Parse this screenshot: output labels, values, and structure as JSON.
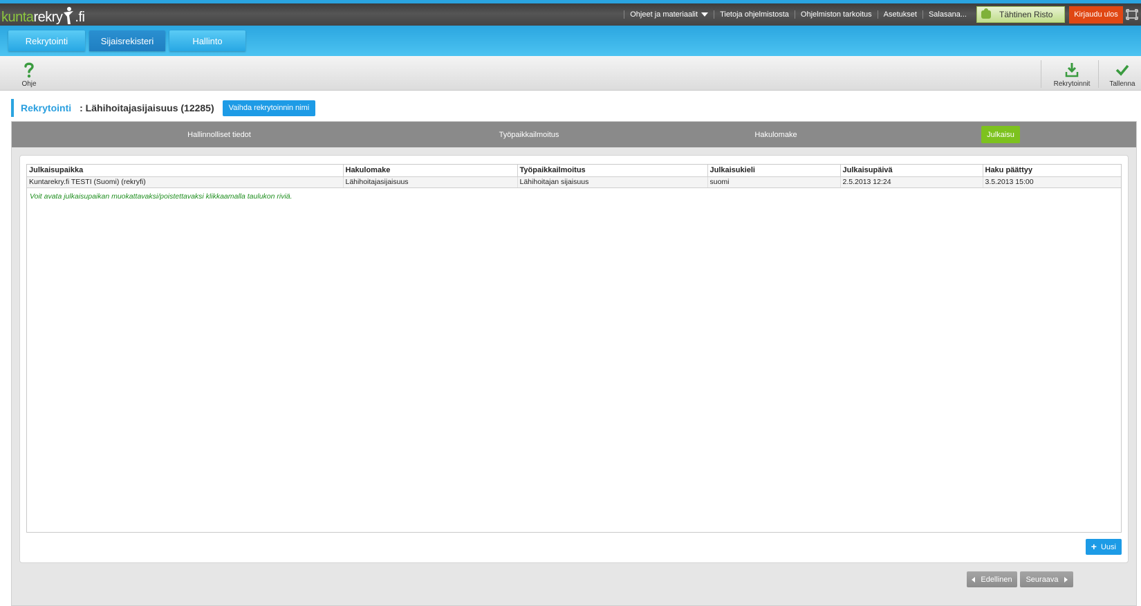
{
  "header": {
    "logo_part1": "kunta",
    "logo_part2": "rekry",
    "logo_part3": ".fi",
    "links": [
      "Ohjeet ja materiaalit",
      "Tietoja ohjelmistosta",
      "Ohjelmiston tarkoitus",
      "Asetukset",
      "Salasana..."
    ],
    "user_name": "Tähtinen Risto",
    "logout_label": "Kirjaudu ulos",
    "user_bg": "#c8e29a",
    "logout_bg": "#e04713"
  },
  "nav": {
    "tabs": [
      "Rekrytointi",
      "Sijaisrekisteri",
      "Hallinto"
    ]
  },
  "toolbar": {
    "help_label": "Ohje",
    "recruitments_label": "Rekrytoinnit",
    "save_label": "Tallenna"
  },
  "page": {
    "section_label": "Rekrytointi",
    "recruitment_title": ": Lähihoitajasijaisuus (12285)",
    "rename_button": "Vaihda rekrytoinnin nimi"
  },
  "steps": [
    "Hallinnolliset tiedot",
    "Työpaikkailmoitus",
    "Hakulomake",
    "Julkaisu"
  ],
  "table": {
    "columns": [
      "Julkaisupaikka",
      "Hakulomake",
      "Työpaikkailmoitus",
      "Julkaisukieli",
      "Julkaisupäivä",
      "Haku päättyy"
    ],
    "rows": [
      [
        "Kuntarekry.fi TESTI (Suomi) (rekryfi)",
        "Lähihoitajasijaisuus",
        "Lähihoitajan sijaisuus",
        "suomi",
        "2.5.2013 12:24",
        "3.5.2013 15:00"
      ]
    ],
    "hint": "Voit avata julkaisupaikan muokattavaksi/poistettavaksi klikkaamalla taulukon riviä."
  },
  "actions": {
    "new_label": "Uusi",
    "prev_label": "Edellinen",
    "next_label": "Seuraava"
  },
  "colors": {
    "accent_blue": "#2aa4e0",
    "active_step": "#7dc21e",
    "hint_green": "#1e8e1e"
  }
}
